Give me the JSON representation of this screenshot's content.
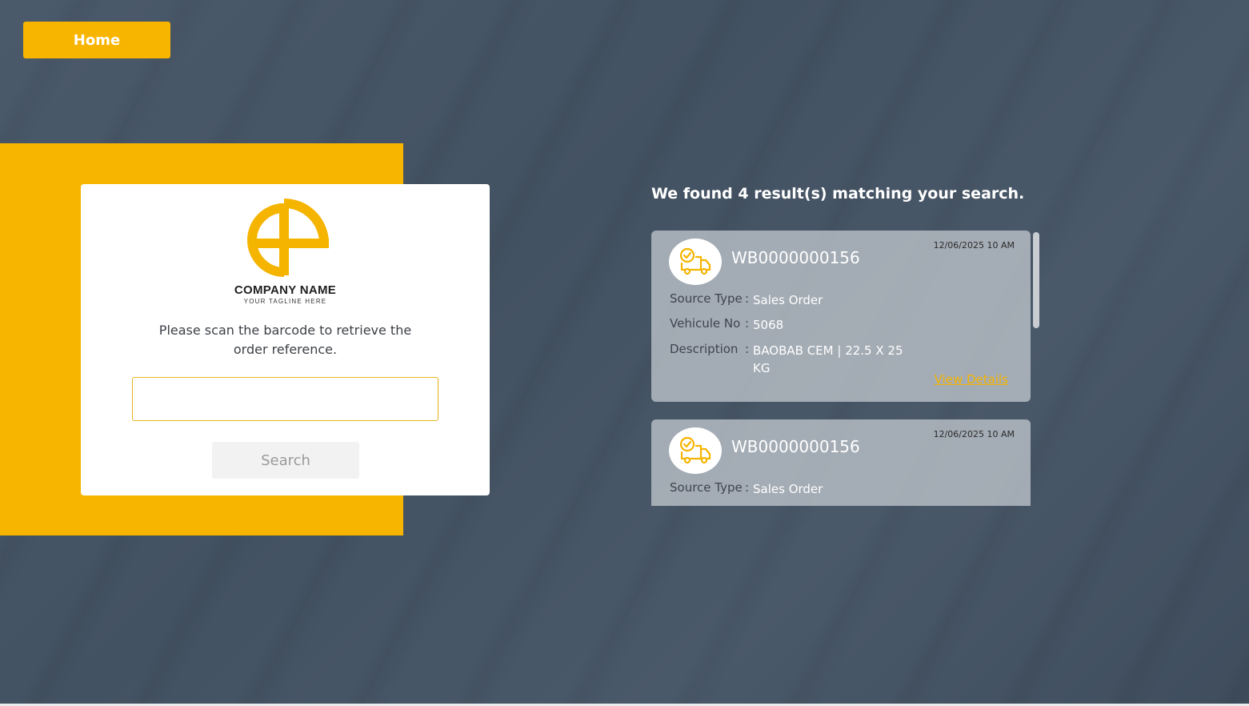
{
  "nav": {
    "home_label": "Home"
  },
  "brand": {
    "company_name": "COMPANY NAME",
    "tagline": "YOUR TAGLINE HERE",
    "accent_color": "#f7b500",
    "logo_icon": "brand-logo-icon"
  },
  "scan": {
    "prompt": "Please scan the barcode to retrieve the order reference.",
    "input_value": "",
    "input_placeholder": "",
    "search_label": "Search"
  },
  "results": {
    "heading": "We found 4 result(s) matching your search.",
    "items": [
      {
        "icon": "delivery-truck-check-icon",
        "reference": "WB0000000156",
        "date": "12/06/2025 10 AM",
        "source_type_label": "Source Type",
        "source_type": "Sales Order",
        "vehicle_label": "Vehicule No",
        "vehicle": "5068",
        "description_label": "Description",
        "description": "BAOBAB CEM | 22.5 X 25 KG",
        "view_details_label": "View Details"
      },
      {
        "icon": "delivery-truck-check-icon",
        "reference": "WB0000000156",
        "date": "12/06/2025 10 AM",
        "source_type_label": "Source Type",
        "source_type": "Sales Order"
      }
    ]
  }
}
